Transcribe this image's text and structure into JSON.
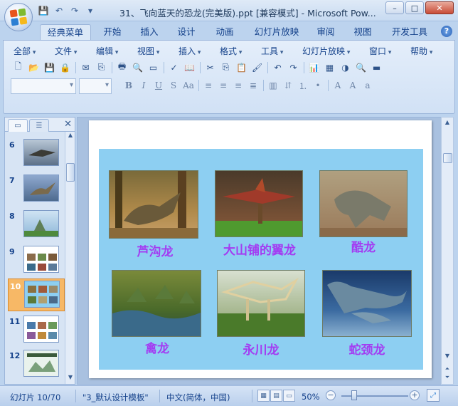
{
  "window": {
    "title": "31、飞向蓝天的恐龙(完美版).ppt [兼容模式] - Microsoft Pow...",
    "controls": [
      "–",
      "□",
      "✕"
    ]
  },
  "qat": {
    "save": "💾",
    "undo": "↶",
    "redo": "↷",
    "customize": "▾"
  },
  "tabs": [
    {
      "label": "经典菜单",
      "active": true
    },
    {
      "label": "开始"
    },
    {
      "label": "插入"
    },
    {
      "label": "设计"
    },
    {
      "label": "动画"
    },
    {
      "label": "幻灯片放映"
    },
    {
      "label": "审阅"
    },
    {
      "label": "视图"
    },
    {
      "label": "开发工具"
    }
  ],
  "menus": [
    "全部",
    "文件",
    "编辑",
    "视图",
    "插入",
    "格式",
    "工具",
    "幻灯片放映",
    "窗口",
    "帮助"
  ],
  "toolbar_icons": [
    "new-icon",
    "open-icon",
    "save-icon",
    "permission-icon",
    "print-preview-icon",
    "sep",
    "cut-icon",
    "copy-icon",
    "paste-icon",
    "format-painter-icon",
    "undo-icon",
    "redo-icon",
    "chart-icon",
    "table-icon",
    "color-icon",
    "fill-icon"
  ],
  "format_icons": [
    "B",
    "I",
    "U",
    "S",
    "Aa",
    "A"
  ],
  "slides_panel": {
    "items": [
      {
        "num": "6"
      },
      {
        "num": "7"
      },
      {
        "num": "8"
      },
      {
        "num": "9"
      },
      {
        "num": "10",
        "selected": true
      },
      {
        "num": "11"
      },
      {
        "num": "12"
      }
    ]
  },
  "slide": {
    "captions": [
      "芦沟龙",
      "大山铺的翼龙",
      "酷龙",
      "禽龙",
      "永川龙",
      "蛇颈龙"
    ]
  },
  "status": {
    "slide_pos": "幻灯片 10/70",
    "template": "\"3_默认设计模板\"",
    "language": "中文(简体，中国)",
    "zoom": "50%"
  }
}
